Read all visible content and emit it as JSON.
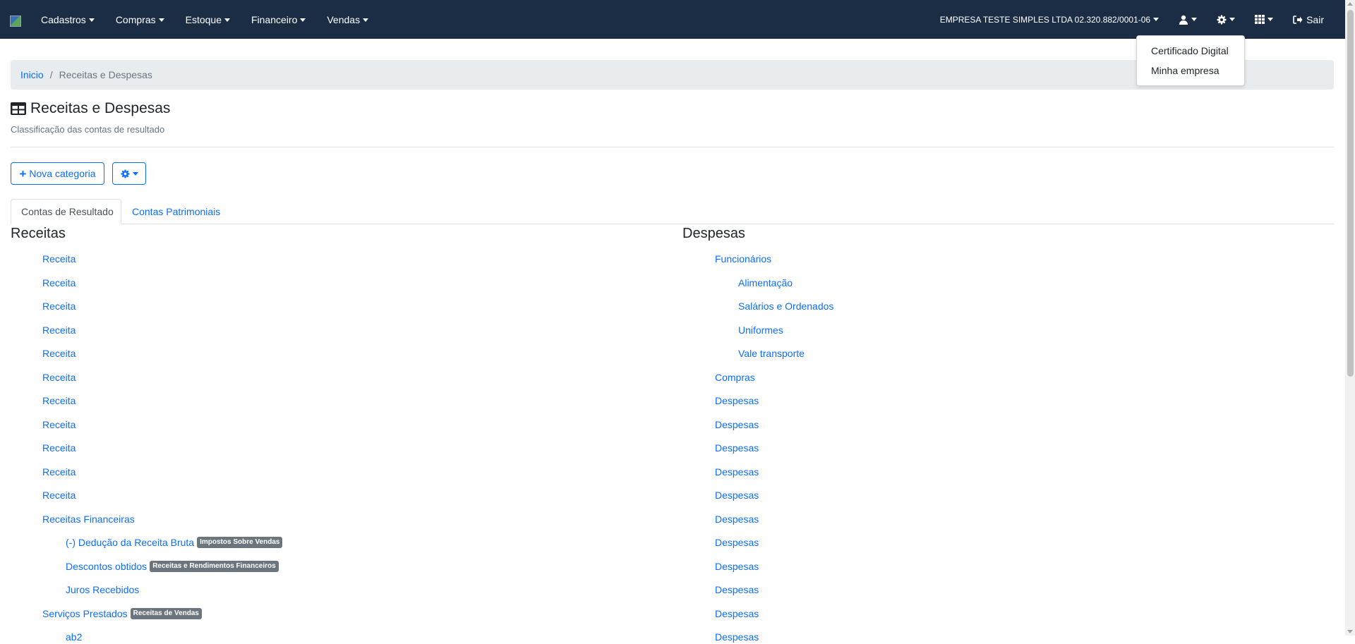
{
  "navbar": {
    "menus": [
      "Cadastros",
      "Compras",
      "Estoque",
      "Financeiro",
      "Vendas"
    ],
    "company": "EMPRESA TESTE SIMPLES LTDA 02.320.882/0001-06",
    "logout": "Sair"
  },
  "dropdown": {
    "items": [
      "Certificado Digital",
      "Minha empresa"
    ]
  },
  "breadcrumb": {
    "home": "Inicio",
    "separator": "/",
    "current": "Receitas e Despesas"
  },
  "page": {
    "title": "Receitas e Despesas",
    "subtitle": "Classificação das contas de resultado"
  },
  "toolbar": {
    "new_category": "Nova categoria"
  },
  "tabs": [
    "Contas de Resultado",
    "Contas Patrimoniais"
  ],
  "receitas": {
    "heading": "Receitas",
    "items": [
      {
        "label": "Receita",
        "level": 1
      },
      {
        "label": "Receita",
        "level": 1
      },
      {
        "label": "Receita",
        "level": 1
      },
      {
        "label": "Receita",
        "level": 1
      },
      {
        "label": "Receita",
        "level": 1
      },
      {
        "label": "Receita",
        "level": 1
      },
      {
        "label": "Receita",
        "level": 1
      },
      {
        "label": "Receita",
        "level": 1
      },
      {
        "label": "Receita",
        "level": 1
      },
      {
        "label": "Receita",
        "level": 1
      },
      {
        "label": "Receita",
        "level": 1
      },
      {
        "label": "Receitas Financeiras",
        "level": 1
      },
      {
        "label": "(-) Dedução da Receita Bruta",
        "level": 2,
        "badge": "Impostos Sobre Vendas"
      },
      {
        "label": "Descontos obtidos",
        "level": 2,
        "badge": "Receitas e Rendimentos Financeiros"
      },
      {
        "label": "Juros Recebidos",
        "level": 2
      },
      {
        "label": "Serviços Prestados",
        "level": 1,
        "badge": "Receitas de Vendas"
      },
      {
        "label": "ab2",
        "level": 2
      }
    ]
  },
  "despesas": {
    "heading": "Despesas",
    "items": [
      {
        "label": "Funcionários",
        "level": 1
      },
      {
        "label": "Alimentação",
        "level": 2
      },
      {
        "label": "Salários e Ordenados",
        "level": 2
      },
      {
        "label": "Uniformes",
        "level": 2
      },
      {
        "label": "Vale transporte",
        "level": 2
      },
      {
        "label": "Compras",
        "level": 1
      },
      {
        "label": "Despesas",
        "level": 1
      },
      {
        "label": "Despesas",
        "level": 1
      },
      {
        "label": "Despesas",
        "level": 1
      },
      {
        "label": "Despesas",
        "level": 1
      },
      {
        "label": "Despesas",
        "level": 1
      },
      {
        "label": "Despesas",
        "level": 1
      },
      {
        "label": "Despesas",
        "level": 1
      },
      {
        "label": "Despesas",
        "level": 1
      },
      {
        "label": "Despesas",
        "level": 1
      },
      {
        "label": "Despesas",
        "level": 1
      },
      {
        "label": "Despesas",
        "level": 1
      }
    ]
  },
  "icons": {
    "brand": "broken-image-icon",
    "title": "table-icon",
    "user": "user-icon",
    "settings": "gear-icon",
    "apps": "grid-icon",
    "logout": "sign-out-icon",
    "new": "plus-icon"
  },
  "colors": {
    "navbar": "#1b2c45",
    "link": "#0d6efd",
    "badge": "#6c757d",
    "breadcrumb_bg": "#e9ecef"
  }
}
